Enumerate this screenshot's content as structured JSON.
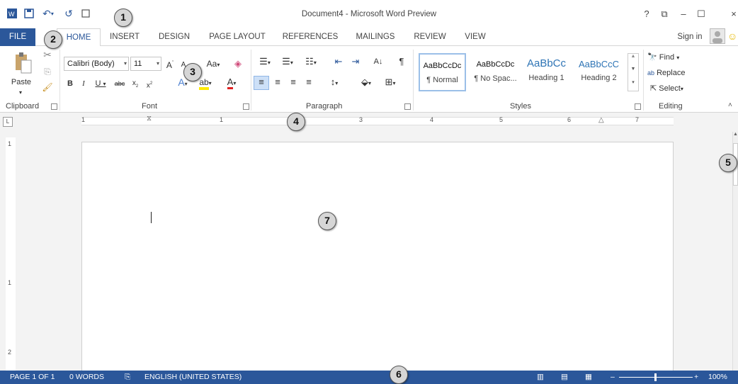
{
  "titlebar": {
    "title": "Document4 - Microsoft Word Preview",
    "help": "?",
    "qat_icons": [
      "word-logo-icon",
      "save-icon",
      "undo-icon",
      "redo-icon",
      "touch-mode-icon"
    ]
  },
  "tabs": {
    "file": "FILE",
    "items": [
      "HOME",
      "INSERT",
      "DESIGN",
      "PAGE LAYOUT",
      "REFERENCES",
      "MAILINGS",
      "REVIEW",
      "VIEW"
    ],
    "sign_in": "Sign in"
  },
  "ribbon": {
    "clipboard": {
      "label": "Clipboard",
      "paste": "Paste"
    },
    "font": {
      "label": "Font",
      "font_name": "Calibri (Body)",
      "font_size": "11",
      "aa": "Aa"
    },
    "paragraph": {
      "label": "Paragraph"
    },
    "styles": {
      "label": "Styles",
      "items": [
        {
          "sample": "AaBbCcDc",
          "name": "¶ Normal"
        },
        {
          "sample": "AaBbCcDc",
          "name": "¶ No Spac..."
        },
        {
          "sample": "AaBbCc",
          "name": "Heading 1"
        },
        {
          "sample": "AaBbCcC",
          "name": "Heading 2"
        }
      ]
    },
    "editing": {
      "label": "Editing",
      "find": "Find",
      "replace": "Replace",
      "select": "Select"
    }
  },
  "ruler": {
    "numbers": [
      "1",
      "1",
      "2",
      "3",
      "4",
      "5",
      "6",
      "7"
    ]
  },
  "statusbar": {
    "page": "PAGE 1 OF 1",
    "words": "0 WORDS",
    "language": "ENGLISH (UNITED STATES)",
    "zoom": "100%"
  },
  "callouts": [
    "1",
    "2",
    "3",
    "4",
    "5",
    "6",
    "7"
  ],
  "colors": {
    "accent": "#2b579a",
    "status_bar": "#2b579a"
  }
}
